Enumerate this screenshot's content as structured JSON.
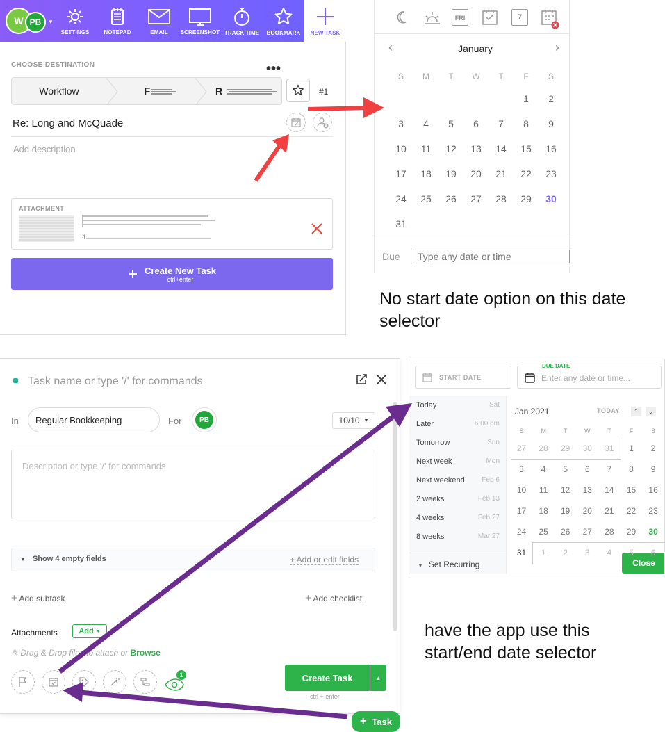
{
  "extension": {
    "avatar_w": "W",
    "avatar_pb": "PB",
    "tools": [
      {
        "label": "SETTINGS",
        "icon": "gear-icon"
      },
      {
        "label": "NOTEPAD",
        "icon": "notepad-icon"
      },
      {
        "label": "EMAIL",
        "icon": "email-icon"
      },
      {
        "label": "SCREENSHOT",
        "icon": "monitor-icon"
      },
      {
        "label": "TRACK TIME",
        "icon": "stopwatch-icon"
      },
      {
        "label": "BOOKMARK",
        "icon": "star-icon"
      },
      {
        "label": "NEW TASK",
        "icon": "plus-icon"
      }
    ],
    "choose_destination": "CHOOSE DESTINATION",
    "breadcrumb": [
      "Workflow",
      "F",
      "R"
    ],
    "task_number": "#1",
    "task_title": "Re: Long and McQuade",
    "description_placeholder": "Add description",
    "attachment_label": "ATTACHMENT",
    "attachment_count": "4",
    "create_label": "Create New Task",
    "create_shortcut": "ctrl+enter"
  },
  "calendar": {
    "month": "January",
    "weekdays": [
      "S",
      "M",
      "T",
      "W",
      "T",
      "F",
      "S"
    ],
    "weeks": [
      [
        "",
        "",
        "",
        "",
        "",
        "1",
        "2"
      ],
      [
        "3",
        "4",
        "5",
        "6",
        "7",
        "8",
        "9"
      ],
      [
        "10",
        "11",
        "12",
        "13",
        "14",
        "15",
        "16"
      ],
      [
        "17",
        "18",
        "19",
        "20",
        "21",
        "22",
        "23"
      ],
      [
        "24",
        "25",
        "26",
        "27",
        "28",
        "29",
        "30"
      ],
      [
        "31",
        "",
        "",
        "",
        "",
        "",
        ""
      ]
    ],
    "today": "30",
    "due_label": "Due",
    "due_placeholder": "Type any date or time",
    "header_icon_fri": "FRI",
    "header_icon_seven": "7",
    "accent": "#7b68ee"
  },
  "note_top": "No start date option on this date selector",
  "note_bottom": "have the app use this start/end date selector",
  "task_modal": {
    "name_placeholder": "Task name or type '/' for commands",
    "in_label": "In",
    "list_name": "Regular Bookkeeping",
    "for_label": "For",
    "assignee": "PB",
    "status": "10/10",
    "description_placeholder": "Description or type '/' for commands",
    "show_empty": "Show 4 empty fields",
    "add_edit_fields": "+ Add or edit fields",
    "add_subtask": "Add subtask",
    "add_checklist": "Add checklist",
    "attachments": "Attachments",
    "add": "Add",
    "drag_text": "Drag & Drop files to attach or",
    "browse": "Browse",
    "watcher_count": "1",
    "create_task": "Create Task",
    "create_shortcut": "ctrl + enter",
    "task_fab": "Task",
    "green": "#2eb34a"
  },
  "date_picker": {
    "start_placeholder": "START DATE",
    "due_label": "DUE DATE",
    "due_placeholder": "Enter any date or time...",
    "quick": [
      {
        "label": "Today",
        "date": "Sat"
      },
      {
        "label": "Later",
        "date": "6:00 pm"
      },
      {
        "label": "Tomorrow",
        "date": "Sun"
      },
      {
        "label": "Next week",
        "date": "Mon"
      },
      {
        "label": "Next weekend",
        "date": "Feb 6"
      },
      {
        "label": "2 weeks",
        "date": "Feb 13"
      },
      {
        "label": "4 weeks",
        "date": "Feb 27"
      },
      {
        "label": "8 weeks",
        "date": "Mar 27"
      }
    ],
    "set_recurring": "Set Recurring",
    "month": "Jan 2021",
    "today_btn": "TODAY",
    "weekdays": [
      "S",
      "M",
      "T",
      "W",
      "T",
      "F",
      "S"
    ],
    "weeks": [
      [
        "27",
        "28",
        "29",
        "30",
        "31",
        "1",
        "2"
      ],
      [
        "3",
        "4",
        "5",
        "6",
        "7",
        "8",
        "9"
      ],
      [
        "10",
        "11",
        "12",
        "13",
        "14",
        "15",
        "16"
      ],
      [
        "17",
        "18",
        "19",
        "20",
        "21",
        "22",
        "23"
      ],
      [
        "24",
        "25",
        "26",
        "27",
        "28",
        "29",
        "30"
      ],
      [
        "31",
        "1",
        "2",
        "3",
        "4",
        "5",
        "6"
      ]
    ],
    "close": "Close"
  }
}
